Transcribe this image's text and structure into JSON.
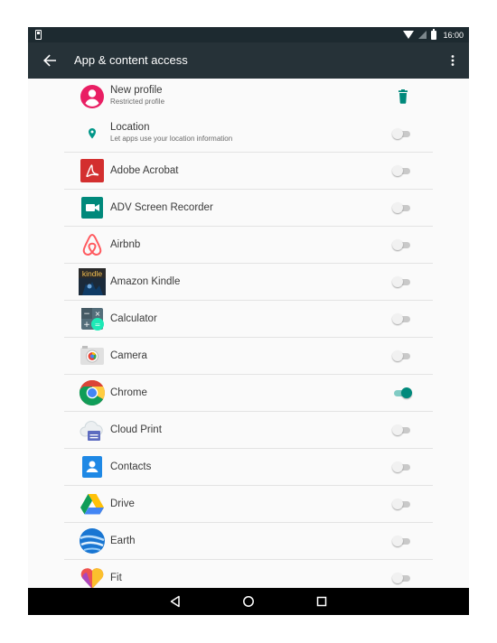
{
  "status_bar": {
    "time": "16:00"
  },
  "app_bar": {
    "title": "App & content access"
  },
  "profile": {
    "title": "New profile",
    "subtitle": "Restricted profile"
  },
  "location": {
    "title": "Location",
    "subtitle": "Let apps use your location information",
    "enabled": false
  },
  "apps": [
    {
      "name": "Adobe Acrobat",
      "icon": "adobe-acrobat-icon",
      "enabled": false
    },
    {
      "name": "ADV Screen Recorder",
      "icon": "adv-screen-recorder-icon",
      "enabled": false
    },
    {
      "name": "Airbnb",
      "icon": "airbnb-icon",
      "enabled": false
    },
    {
      "name": "Amazon Kindle",
      "icon": "amazon-kindle-icon",
      "icon_text": "kindle",
      "enabled": false
    },
    {
      "name": "Calculator",
      "icon": "calculator-icon",
      "enabled": false
    },
    {
      "name": "Camera",
      "icon": "camera-icon",
      "enabled": false
    },
    {
      "name": "Chrome",
      "icon": "chrome-icon",
      "enabled": true
    },
    {
      "name": "Cloud Print",
      "icon": "cloud-print-icon",
      "enabled": false
    },
    {
      "name": "Contacts",
      "icon": "contacts-icon",
      "enabled": false
    },
    {
      "name": "Drive",
      "icon": "drive-icon",
      "enabled": false
    },
    {
      "name": "Earth",
      "icon": "earth-icon",
      "enabled": false
    },
    {
      "name": "Fit",
      "icon": "fit-icon",
      "enabled": false
    }
  ],
  "colors": {
    "app_bar": "#263238",
    "status_bar": "#1d2a30",
    "accent": "#00897b",
    "profile_icon": "#e91e63",
    "nav_bar": "#000000"
  },
  "nav": {
    "back_icon": "triangle-back-icon",
    "home_icon": "circle-home-icon",
    "recents_icon": "square-recents-icon"
  }
}
